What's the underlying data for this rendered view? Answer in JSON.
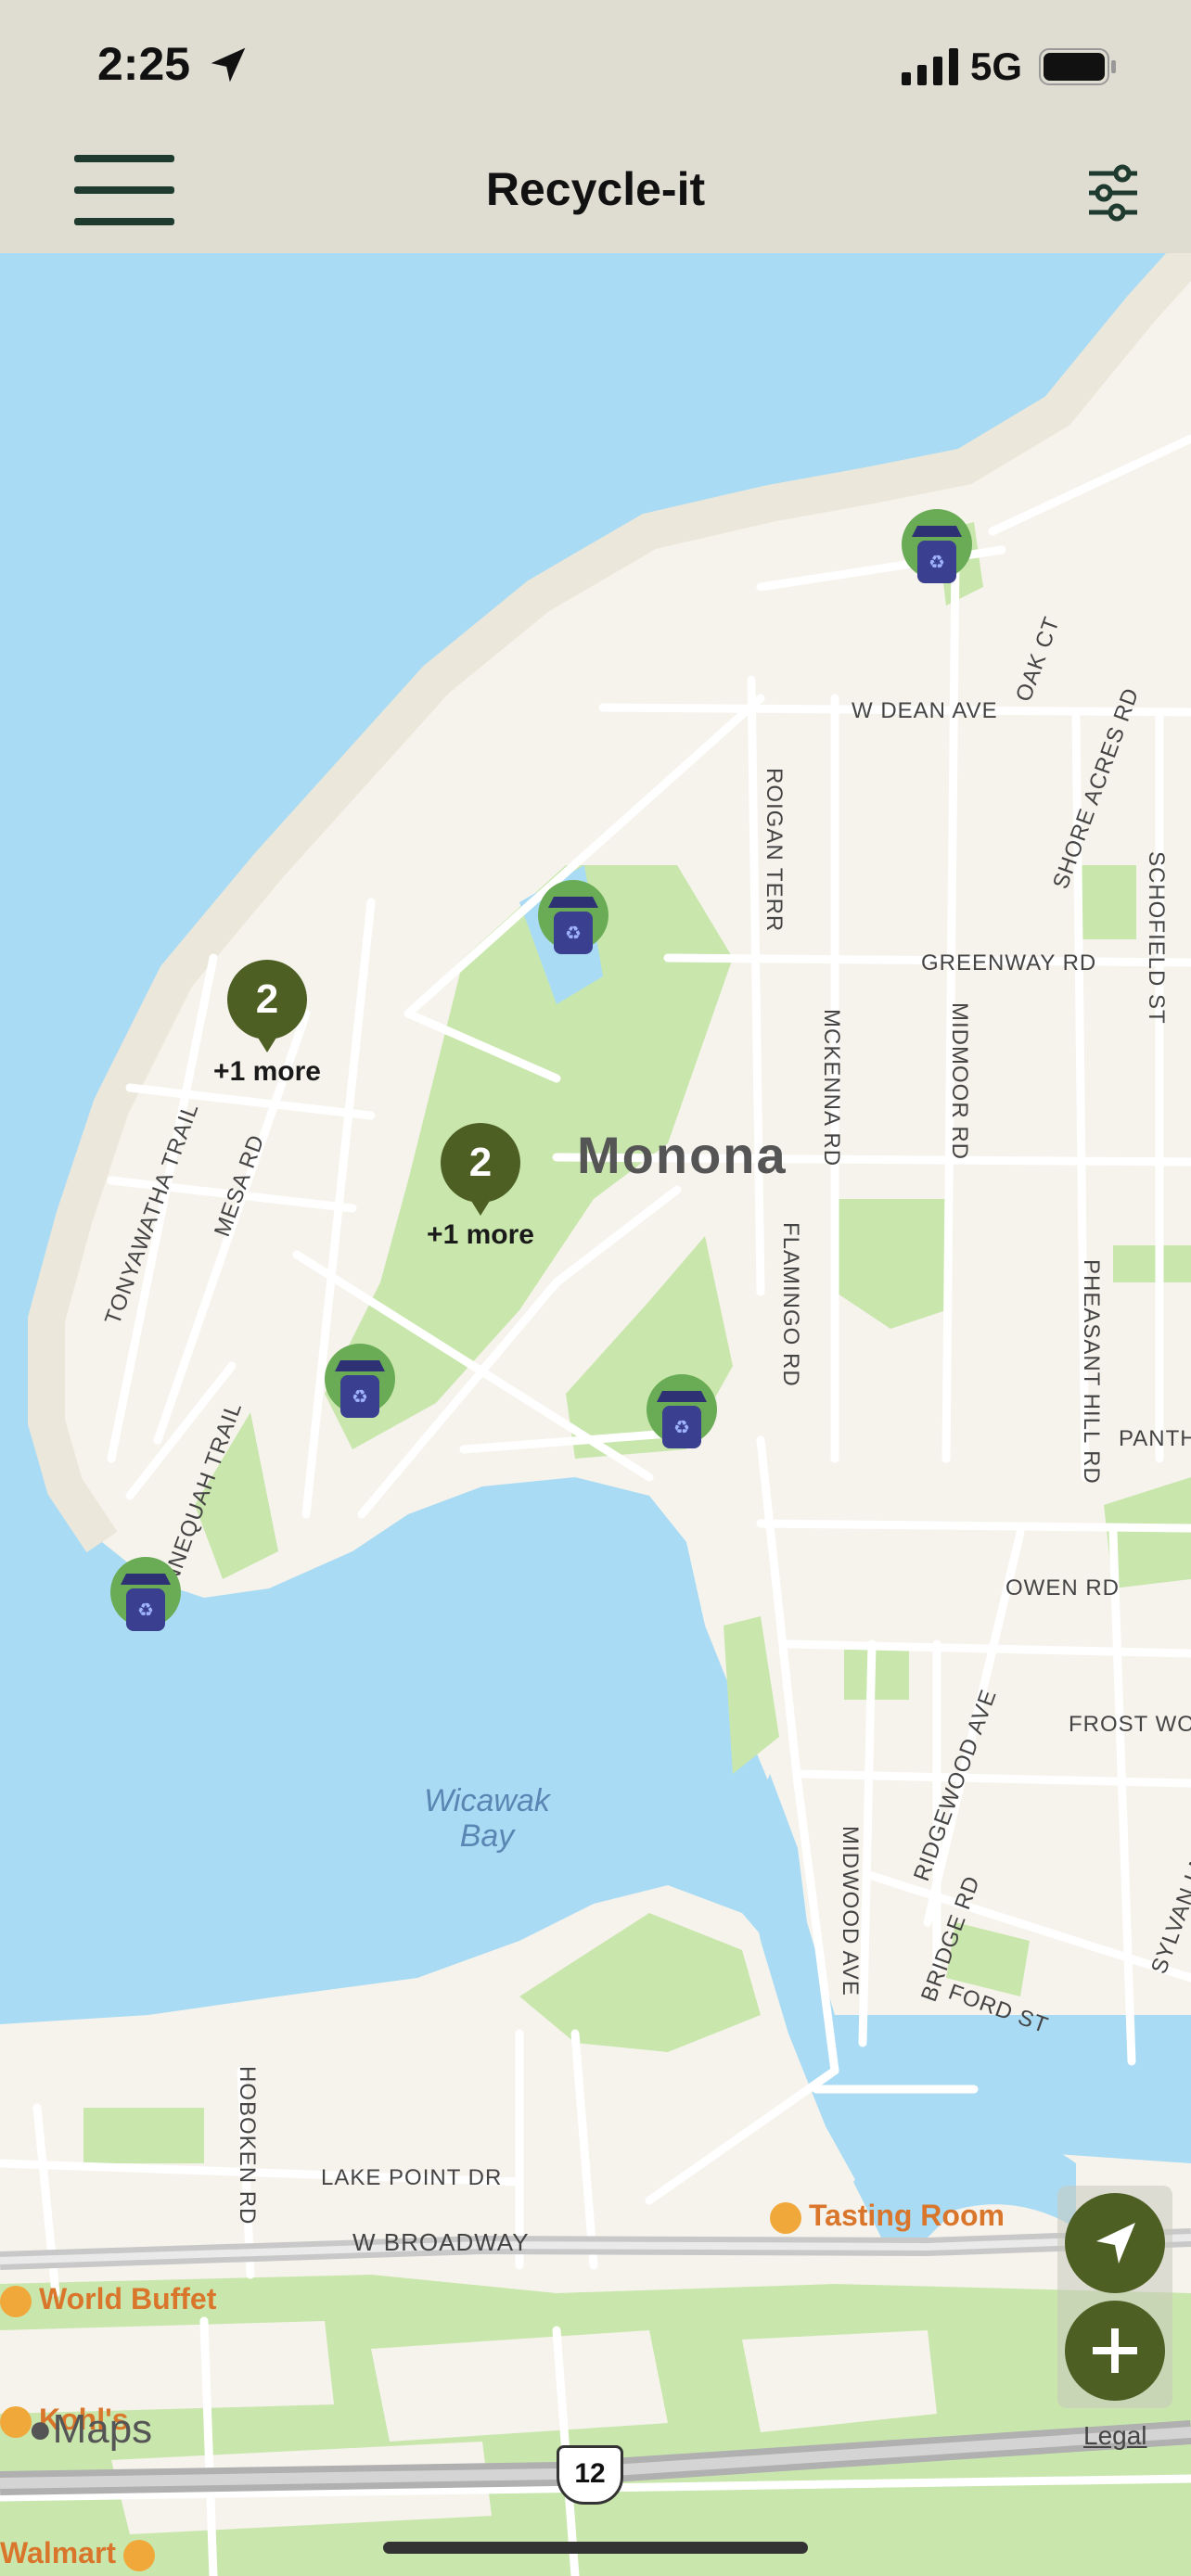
{
  "status": {
    "time": "2:25",
    "network": "5G"
  },
  "header": {
    "title": "Recycle-it",
    "menu_icon": "hamburger-menu-icon",
    "filter_icon": "sliders-filter-icon"
  },
  "map": {
    "place_label": "Monona",
    "bay_label": "Wicawak\nBay",
    "streets": [
      "W DEAN AVE",
      "OAK CT",
      "SHORE ACRES RD",
      "ROIGAN TERR",
      "SCHOFIELD ST",
      "GREENWAY RD",
      "MCKENNA RD",
      "MIDMOOR RD",
      "TONYAWATHA TRAIL",
      "MESA RD",
      "FLAMINGO RD",
      "PHEASANT HILL RD",
      "PANTH",
      "NNEQUAH TRAIL",
      "OWEN RD",
      "FROST WO",
      "RIDGEWOOD AVE",
      "MIDWOOD AVE",
      "BRIDGE RD",
      "FORD ST",
      "SYLVAN LN",
      "HOBOKEN RD",
      "LAKE POINT DR",
      "W BROADWAY"
    ],
    "pois": [
      "Tasting Room",
      "World Buffet",
      "Kohl's",
      "Walmart"
    ],
    "highway_shield": "12",
    "clusters": [
      {
        "count": "2",
        "more": "+1 more"
      },
      {
        "count": "2",
        "more": "+1 more"
      }
    ],
    "marker_icon": "recycle-bin-icon",
    "attribution": "Maps",
    "legal": "Legal"
  },
  "controls": {
    "locate_icon": "location-arrow-icon",
    "add_icon": "plus-icon"
  },
  "colors": {
    "header_bg": "#dfddd2",
    "water": "#a9dcf4",
    "land": "#f6f3ec",
    "park": "#c9e7ad",
    "accent": "#4e5f24",
    "poi": "#d9762b"
  }
}
